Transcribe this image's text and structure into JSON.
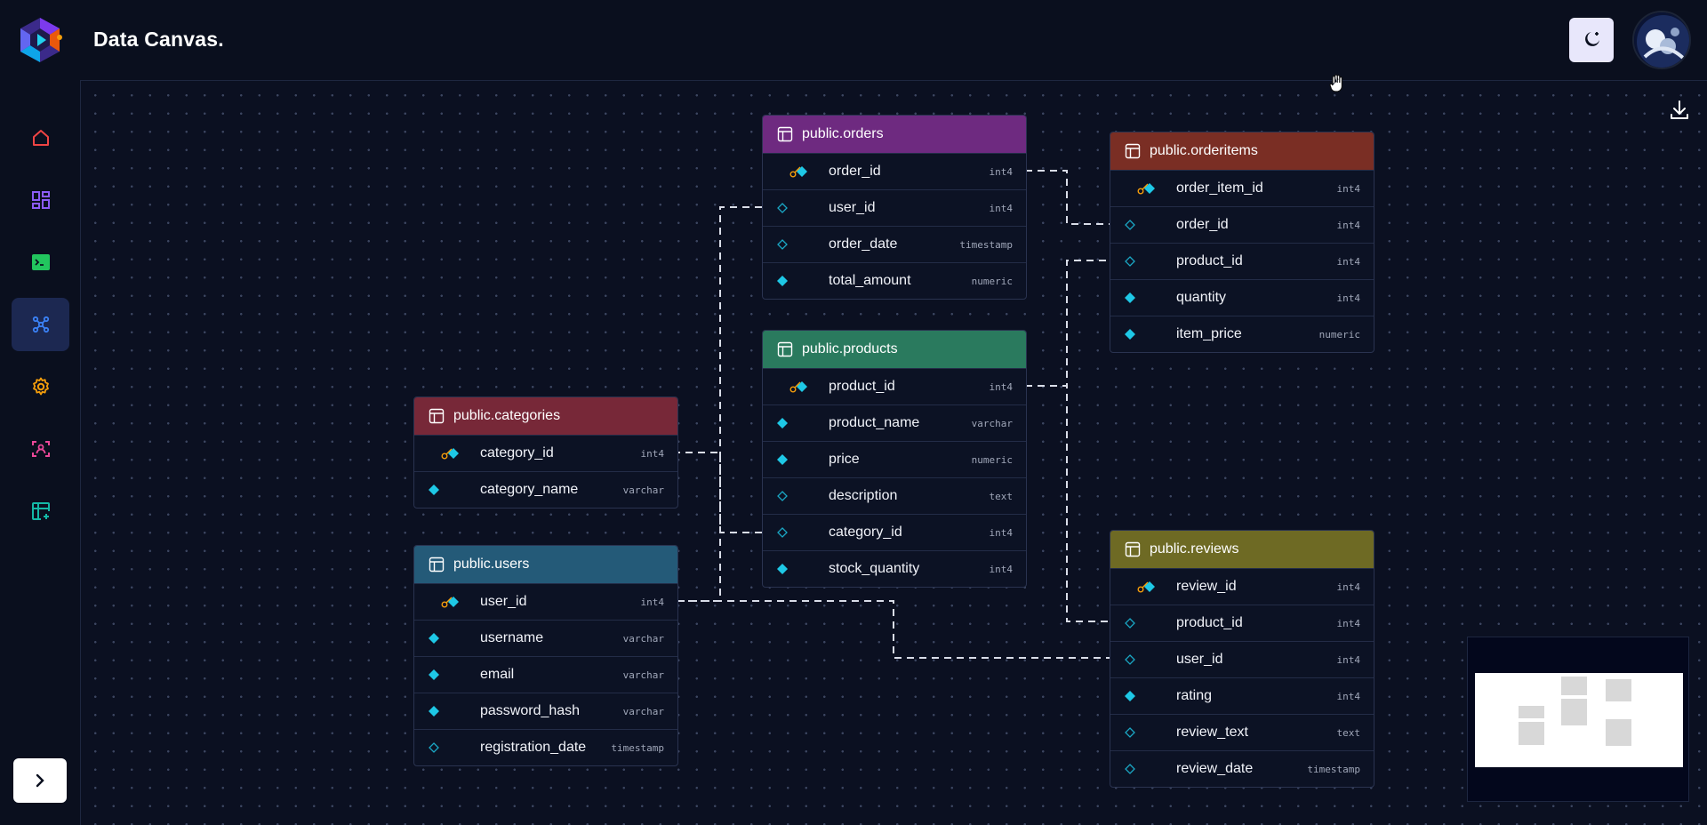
{
  "app": {
    "title": "Data Canvas."
  },
  "header": {
    "theme_icon": "moon-star-icon",
    "avatar": "user-avatar"
  },
  "sidebar": {
    "items": [
      {
        "name": "home",
        "icon": "home-icon",
        "color": "#ef4444",
        "active": false
      },
      {
        "name": "dashboard",
        "icon": "grid-icon",
        "color": "#8b5cf6",
        "active": false
      },
      {
        "name": "terminal",
        "icon": "terminal-icon",
        "color": "#22c55e",
        "active": false
      },
      {
        "name": "schema",
        "icon": "network-icon",
        "color": "#3b82f6",
        "active": true
      },
      {
        "name": "settings",
        "icon": "gear-icon",
        "color": "#f59e0b",
        "active": false
      },
      {
        "name": "scan",
        "icon": "scan-icon",
        "color": "#ec4899",
        "active": false
      },
      {
        "name": "add-table",
        "icon": "table-plus-icon",
        "color": "#14b8a6",
        "active": false
      }
    ],
    "expand_icon": "chevron-right-icon"
  },
  "tables": [
    {
      "id": "orders",
      "name": "public.orders",
      "color": "#6e2a80",
      "columns": [
        {
          "name": "order_id",
          "type": "int4",
          "pk": true,
          "filled": true
        },
        {
          "name": "user_id",
          "type": "int4",
          "pk": false,
          "filled": false
        },
        {
          "name": "order_date",
          "type": "timestamp",
          "pk": false,
          "filled": false
        },
        {
          "name": "total_amount",
          "type": "numeric",
          "pk": false,
          "filled": true
        }
      ]
    },
    {
      "id": "orderitems",
      "name": "public.orderitems",
      "color": "#7a2e24",
      "columns": [
        {
          "name": "order_item_id",
          "type": "int4",
          "pk": true,
          "filled": true
        },
        {
          "name": "order_id",
          "type": "int4",
          "pk": false,
          "filled": false
        },
        {
          "name": "product_id",
          "type": "int4",
          "pk": false,
          "filled": false
        },
        {
          "name": "quantity",
          "type": "int4",
          "pk": false,
          "filled": true
        },
        {
          "name": "item_price",
          "type": "numeric",
          "pk": false,
          "filled": true
        }
      ]
    },
    {
      "id": "products",
      "name": "public.products",
      "color": "#2a7a5e",
      "columns": [
        {
          "name": "product_id",
          "type": "int4",
          "pk": true,
          "filled": true
        },
        {
          "name": "product_name",
          "type": "varchar",
          "pk": false,
          "filled": true
        },
        {
          "name": "price",
          "type": "numeric",
          "pk": false,
          "filled": true
        },
        {
          "name": "description",
          "type": "text",
          "pk": false,
          "filled": false
        },
        {
          "name": "category_id",
          "type": "int4",
          "pk": false,
          "filled": false
        },
        {
          "name": "stock_quantity",
          "type": "int4",
          "pk": false,
          "filled": true
        }
      ]
    },
    {
      "id": "categories",
      "name": "public.categories",
      "color": "#772838",
      "columns": [
        {
          "name": "category_id",
          "type": "int4",
          "pk": true,
          "filled": true
        },
        {
          "name": "category_name",
          "type": "varchar",
          "pk": false,
          "filled": true
        }
      ]
    },
    {
      "id": "users",
      "name": "public.users",
      "color": "#245a78",
      "columns": [
        {
          "name": "user_id",
          "type": "int4",
          "pk": true,
          "filled": true
        },
        {
          "name": "username",
          "type": "varchar",
          "pk": false,
          "filled": true
        },
        {
          "name": "email",
          "type": "varchar",
          "pk": false,
          "filled": true
        },
        {
          "name": "password_hash",
          "type": "varchar",
          "pk": false,
          "filled": true
        },
        {
          "name": "registration_date",
          "type": "timestamp",
          "pk": false,
          "filled": false
        }
      ]
    },
    {
      "id": "reviews",
      "name": "public.reviews",
      "color": "#6e6a24",
      "columns": [
        {
          "name": "review_id",
          "type": "int4",
          "pk": true,
          "filled": true
        },
        {
          "name": "product_id",
          "type": "int4",
          "pk": false,
          "filled": false
        },
        {
          "name": "user_id",
          "type": "int4",
          "pk": false,
          "filled": false
        },
        {
          "name": "rating",
          "type": "int4",
          "pk": false,
          "filled": true
        },
        {
          "name": "review_text",
          "type": "text",
          "pk": false,
          "filled": false
        },
        {
          "name": "review_date",
          "type": "timestamp",
          "pk": false,
          "filled": false
        }
      ]
    }
  ],
  "canvas": {
    "download_icon": "download-icon",
    "cursor_icon": "hand-cursor-icon",
    "minimap": "minimap"
  }
}
